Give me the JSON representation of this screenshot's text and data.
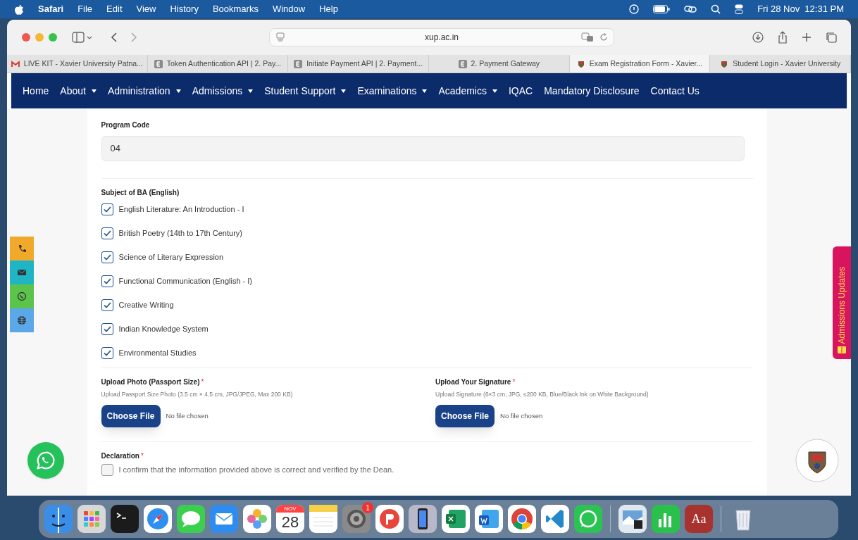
{
  "menubar": {
    "items": [
      "Safari",
      "File",
      "Edit",
      "View",
      "History",
      "Bookmarks",
      "Window",
      "Help"
    ],
    "clock": "Fri 28 Nov  12:31 PM"
  },
  "browser": {
    "url": "xup.ac.in",
    "tabs": [
      {
        "label": "LIVE KIT - Xavier University Patna...",
        "kind": "mail",
        "selected": false
      },
      {
        "label": "Token Authentication API | 2. Pay...",
        "kind": "letter",
        "selected": false
      },
      {
        "label": "Initiate Payment API | 2. Payment...",
        "kind": "letter",
        "selected": false
      },
      {
        "label": "2. Payment Gateway",
        "kind": "letter",
        "selected": false
      },
      {
        "label": "Exam Registration Form - Xavier...",
        "kind": "crest",
        "selected": true
      },
      {
        "label": "Student Login - Xavier University",
        "kind": "crest",
        "selected": false
      }
    ]
  },
  "nav": [
    {
      "label": "Home",
      "dropdown": false
    },
    {
      "label": "About",
      "dropdown": true
    },
    {
      "label": "Administration",
      "dropdown": true
    },
    {
      "label": "Admissions",
      "dropdown": true
    },
    {
      "label": "Student Support",
      "dropdown": true
    },
    {
      "label": "Examinations",
      "dropdown": true
    },
    {
      "label": "Academics",
      "dropdown": true
    },
    {
      "label": "IQAC",
      "dropdown": false
    },
    {
      "label": "Mandatory Disclosure",
      "dropdown": false
    },
    {
      "label": "Contact Us",
      "dropdown": false
    }
  ],
  "form": {
    "program_code": {
      "label": "Program Code",
      "value": "04"
    },
    "subjects": {
      "label": "Subject of BA (English)",
      "items": [
        {
          "label": "English Literature: An Introduction - I",
          "checked": true
        },
        {
          "label": "British Poetry (14th to 17th Century)",
          "checked": true
        },
        {
          "label": "Science of Literary Expression",
          "checked": true
        },
        {
          "label": "Functional Communication (English - I)",
          "checked": true
        },
        {
          "label": "Creative Writing",
          "checked": true
        },
        {
          "label": "Indian Knowledge System",
          "checked": true
        },
        {
          "label": "Environmental Studies",
          "checked": true
        }
      ]
    },
    "uploads": [
      {
        "label": "Upload Photo (Passport Size)",
        "required_mark": "*",
        "hint": "Upload Passport Size Photo (3.5 cm × 4.5 cm, JPG/JPEG, Max 200 KB)",
        "button": "Choose File",
        "status": "No file chosen"
      },
      {
        "label": "Upload Your Signature",
        "required_mark": "*",
        "hint": "Upload Signature (6×3 cm, JPG, ≤200 KB, Blue/Black Ink on White Background)",
        "button": "Choose File",
        "status": "No file chosen"
      }
    ],
    "declaration": {
      "label": "Declaration",
      "required_mark": "*",
      "text": "I confirm that the information provided above is correct and verified by the Dean.",
      "checked": false
    }
  },
  "contact_buttons": [
    {
      "kind": "phone",
      "color": "#f0a92a"
    },
    {
      "kind": "mail",
      "color": "#1fb5c4"
    },
    {
      "kind": "whatsapp",
      "color": "#5cc44c"
    },
    {
      "kind": "globe",
      "color": "#5aa8e8"
    }
  ],
  "updates_tab": "Admissions Updates",
  "dock": [
    {
      "kind": "finder"
    },
    {
      "kind": "launchpad"
    },
    {
      "kind": "terminal"
    },
    {
      "kind": "safari"
    },
    {
      "kind": "messages"
    },
    {
      "kind": "mail"
    },
    {
      "kind": "photos"
    },
    {
      "kind": "calendar",
      "month": "NOV",
      "day": "28"
    },
    {
      "kind": "notes"
    },
    {
      "kind": "settings",
      "badge": "1"
    },
    {
      "kind": "app-red"
    },
    {
      "kind": "phone-mirror"
    },
    {
      "kind": "excel"
    },
    {
      "kind": "word"
    },
    {
      "kind": "chrome"
    },
    {
      "kind": "vscode"
    },
    {
      "kind": "whatsapp"
    },
    {
      "kind": "separator"
    },
    {
      "kind": "preview"
    },
    {
      "kind": "numbers"
    },
    {
      "kind": "dictionary",
      "text": "Aa"
    },
    {
      "kind": "separator"
    },
    {
      "kind": "trash"
    }
  ]
}
